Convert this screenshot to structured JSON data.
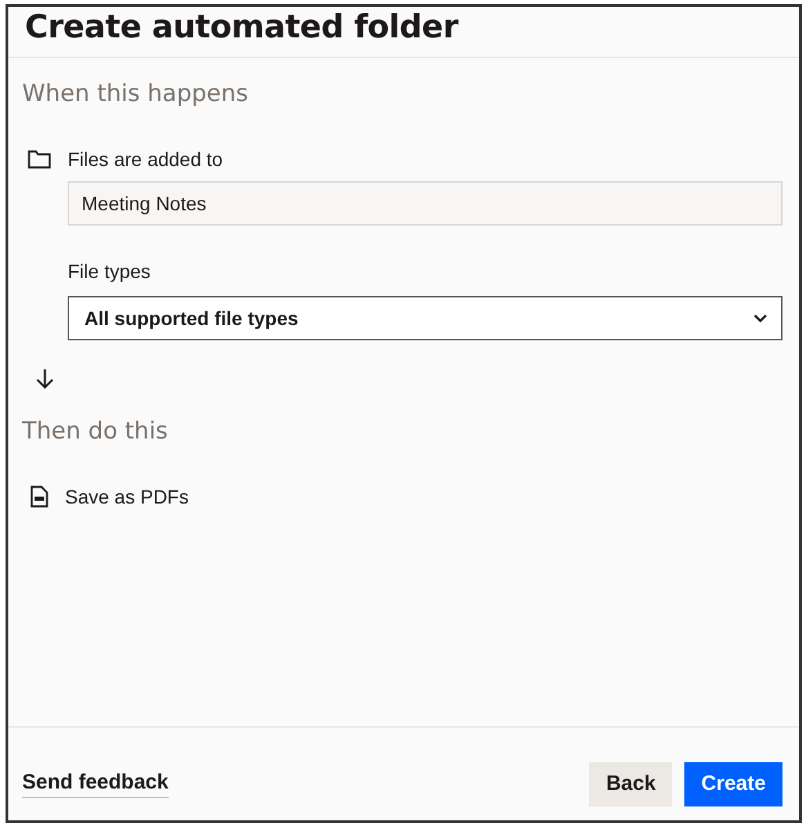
{
  "dialog": {
    "title": "Create automated folder"
  },
  "trigger": {
    "heading": "When this happens",
    "folder_label": "Files are added to",
    "folder_value": "Meeting Notes",
    "file_types_label": "File types",
    "file_types_value": "All supported file types"
  },
  "action": {
    "heading": "Then do this",
    "label": "Save as PDFs"
  },
  "footer": {
    "feedback_link": "Send feedback",
    "buttons": [
      {
        "label": "Back",
        "kind": "secondary"
      },
      {
        "label": "Create",
        "kind": "primary"
      }
    ]
  }
}
